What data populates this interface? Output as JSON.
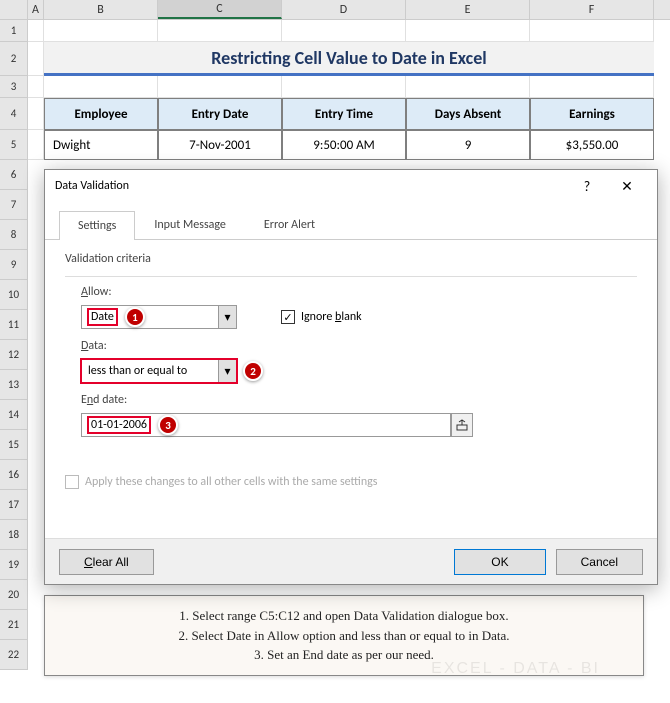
{
  "columns": [
    "A",
    "B",
    "C",
    "D",
    "E",
    "F"
  ],
  "rows_visible": [
    1,
    2,
    3,
    4,
    5,
    6,
    7,
    8,
    9,
    10,
    11,
    12,
    13,
    14,
    15,
    16,
    17,
    18,
    19,
    20,
    21,
    22
  ],
  "title": "Restricting Cell Value to Date in Excel",
  "table": {
    "headers": [
      "Employee",
      "Entry Date",
      "Entry Time",
      "Days Absent",
      "Earnings"
    ],
    "row1": [
      "Dwight",
      "7-Nov-2001",
      "9:50:00 AM",
      "9",
      "$3,550.00"
    ]
  },
  "dialog": {
    "title": "Data Validation",
    "help": "?",
    "close": "✕",
    "tabs": [
      "Settings",
      "Input Message",
      "Error Alert"
    ],
    "section": "Validation criteria",
    "allow_label": "Allow:",
    "allow_value": "Date",
    "ignore_blank": "Ignore blank",
    "data_label": "Data:",
    "data_value": "less than or equal to",
    "end_label": "End date:",
    "end_value": "01-01-2006",
    "apply_all": "Apply these changes to all other cells with the same settings",
    "clear": "Clear All",
    "ok": "OK",
    "cancel": "Cancel"
  },
  "callouts": {
    "n1": "1",
    "n2": "2",
    "n3": "3"
  },
  "instructions": {
    "l1": "1. Select range C5:C12 and open Data Validation dialogue box.",
    "l2": "2. Select Date in Allow option and less than or equal to in Data.",
    "l3": "3. Set an End date as per our need."
  },
  "watermark": "EXCEL - DATA - BI"
}
